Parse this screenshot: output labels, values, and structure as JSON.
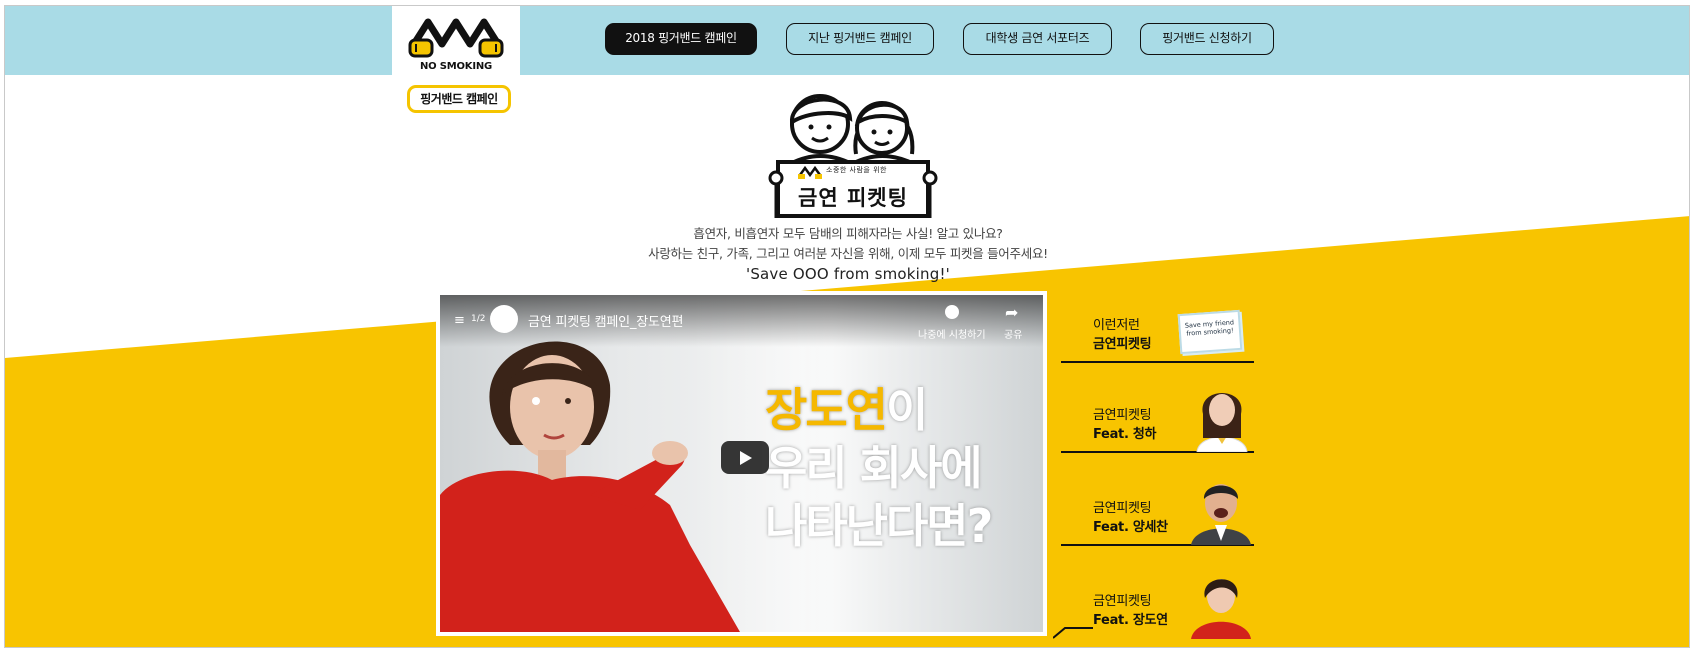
{
  "logo": {
    "caption": "NO SMOKING",
    "badge": "핑거밴드 캠페인"
  },
  "nav": {
    "items": [
      {
        "label": "2018 핑거밴드 캠페인",
        "active": true
      },
      {
        "label": "지난 핑거밴드 캠페인",
        "active": false
      },
      {
        "label": "대학생 금연 서포터즈",
        "active": false
      },
      {
        "label": "핑거밴드 신청하기",
        "active": false
      }
    ]
  },
  "hero": {
    "tagline": "소중한 사람을 위한",
    "sign_title": "금연 피켓팅",
    "intro_line1": "흡연자, 비흡연자 모두 담배의 피해자라는 사실! 알고 있나요?",
    "intro_line2": "사랑하는 친구, 가족, 그리고 여러분 자신을 위해, 이제 모두 피켓을 들어주세요!",
    "save_line": "'Save OOO from smoking!'"
  },
  "video": {
    "playlist_count": "1/2",
    "title": "금연 피켓팅 캠페인_장도연편",
    "watch_later_label": "나중에 시청하기",
    "share_label": "공유",
    "headline_highlight": "장도연",
    "headline_rest1": "이",
    "headline_line2": "우리 회사에",
    "headline_line3": "나타난다면?"
  },
  "side": {
    "items": [
      {
        "line1": "이런저런",
        "line2": "금연피켓팅",
        "thumb_text": "Save my friend from smoking!"
      },
      {
        "line1": "금연피켓팅",
        "line2": "Feat. 청하"
      },
      {
        "line1": "금연피켓팅",
        "line2": "Feat. 양세찬"
      },
      {
        "line1": "금연피켓팅",
        "line2": "Feat. 장도연"
      }
    ]
  },
  "colors": {
    "brand_yellow": "#f5c400",
    "topbar_blue": "#a9dbe6",
    "headline_orange": "#f5b800"
  }
}
